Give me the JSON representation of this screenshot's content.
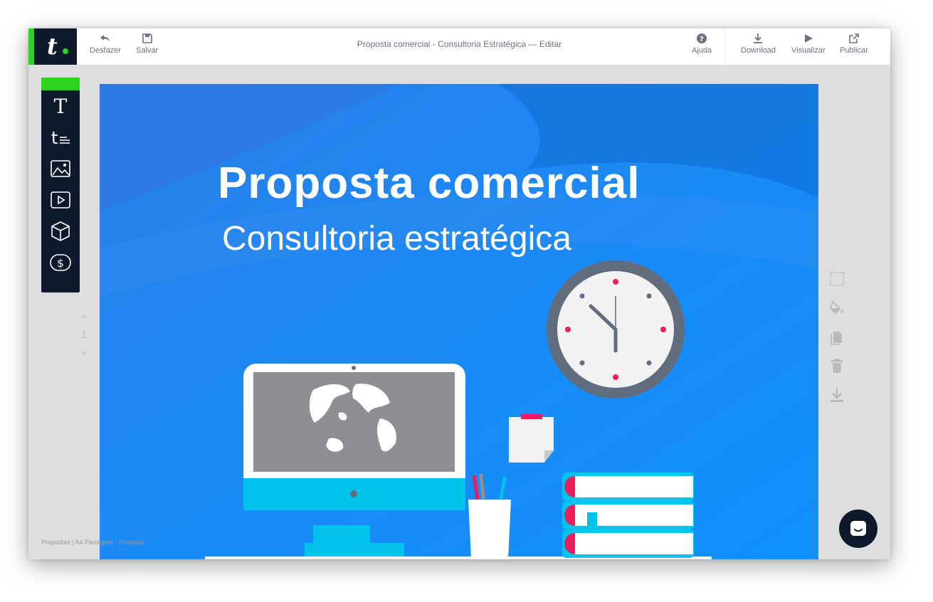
{
  "app": {
    "document_title": "Proposta comercial - Consultoria Estratégica — Editar",
    "brand_colors": {
      "accent": "#2bd41d",
      "dark": "#0e1a2b",
      "canvas_blue": "#1a8cf7"
    }
  },
  "toolbar": {
    "undo_label": "Desfazer",
    "save_label": "Salvar",
    "help_label": "Ajuda",
    "download_label": "Download",
    "preview_label": "Visualizar",
    "publish_label": "Publicar"
  },
  "tools": [
    {
      "name": "text-tool",
      "icon": "text-icon"
    },
    {
      "name": "paragraph-tool",
      "icon": "paragraph-icon"
    },
    {
      "name": "image-tool",
      "icon": "image-icon"
    },
    {
      "name": "video-tool",
      "icon": "video-icon"
    },
    {
      "name": "product-tool",
      "icon": "box-icon"
    },
    {
      "name": "price-tool",
      "icon": "dollar-icon"
    }
  ],
  "pager": {
    "current_page": "1"
  },
  "slide": {
    "title": "Proposta comercial",
    "subtitle": "Consultoria estratégica"
  },
  "side_tools": [
    "selection-icon",
    "fill-bucket-icon",
    "duplicate-icon",
    "trash-icon",
    "download-icon"
  ],
  "footer": {
    "breadcrumb": "Propostas  |  A4 Paisagem · Proposta"
  }
}
